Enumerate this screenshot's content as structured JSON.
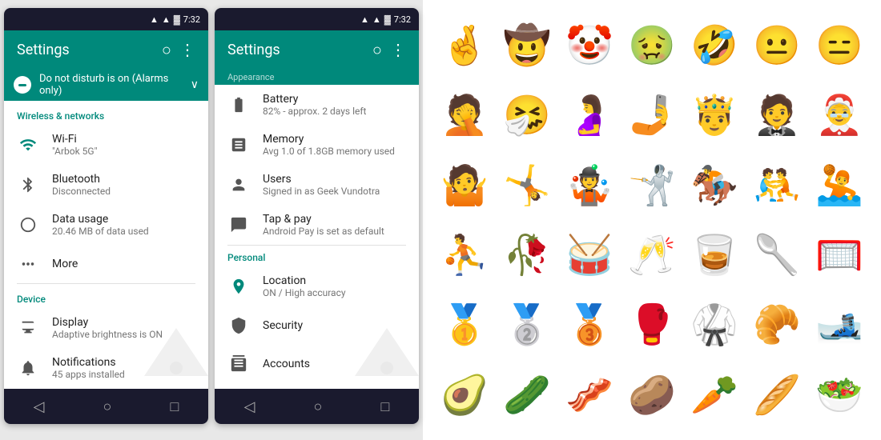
{
  "phone1": {
    "statusBar": {
      "signal": "▲▲▲",
      "time": "7:32"
    },
    "appBar": {
      "title": "Settings",
      "searchIcon": "🔍",
      "moreIcon": "⋮"
    },
    "dnd": {
      "text": "Do not disturb is on (Alarms only)",
      "chevron": "⌄"
    },
    "sections": [
      {
        "header": "Wireless & networks",
        "items": [
          {
            "icon": "wifi",
            "title": "Wi-Fi",
            "subtitle": "\"Arbok 5G\""
          },
          {
            "icon": "bluetooth",
            "title": "Bluetooth",
            "subtitle": "Disconnected"
          },
          {
            "icon": "data",
            "title": "Data usage",
            "subtitle": "20.46 MB of data used"
          },
          {
            "icon": "more",
            "title": "More",
            "subtitle": ""
          }
        ]
      },
      {
        "header": "Device",
        "items": [
          {
            "icon": "display",
            "title": "Display",
            "subtitle": "Adaptive brightness is ON"
          },
          {
            "icon": "notif",
            "title": "Notifications",
            "subtitle": "45 apps installed"
          }
        ]
      }
    ]
  },
  "phone2": {
    "statusBar": {
      "signal": "▲▲▲",
      "time": "7:32"
    },
    "appBar": {
      "title": "Settings",
      "searchIcon": "🔍",
      "moreIcon": "⋮"
    },
    "scrolledHeader": "Appearance",
    "items": [
      {
        "icon": "battery",
        "title": "Battery",
        "subtitle": "82% - approx. 2 days left"
      },
      {
        "icon": "memory",
        "title": "Memory",
        "subtitle": "Avg 1.0 of 1.8GB memory used"
      },
      {
        "icon": "users",
        "title": "Users",
        "subtitle": "Signed in as Geek Vundotra"
      },
      {
        "icon": "tap",
        "title": "Tap & pay",
        "subtitle": "Android Pay is set as default"
      }
    ],
    "personalHeader": "Personal",
    "personalItems": [
      {
        "icon": "location",
        "title": "Location",
        "subtitle": "ON / High accuracy"
      },
      {
        "icon": "security",
        "title": "Security",
        "subtitle": ""
      },
      {
        "icon": "accounts",
        "title": "Accounts",
        "subtitle": ""
      }
    ]
  },
  "emojis": [
    "🤞",
    "🤠",
    "🤡",
    "🤢",
    "🤣",
    "😐",
    "😑",
    "🤦",
    "🤧",
    "🤰",
    "🤳",
    "🤴",
    "🤵",
    "🤶",
    "🤷",
    "🤸",
    "🤹",
    "🤺",
    "🏇",
    "🤼",
    "🤽",
    "⛹",
    "🥀",
    "🥁",
    "🥂",
    "🥃",
    "🥄",
    "🥅",
    "🥇",
    "🥈",
    "🥉",
    "🥊",
    "🥋",
    "🥐",
    "",
    "🥑",
    "🥒",
    "🥓",
    "🥔",
    "🥕",
    "🥖",
    "🥗"
  ]
}
